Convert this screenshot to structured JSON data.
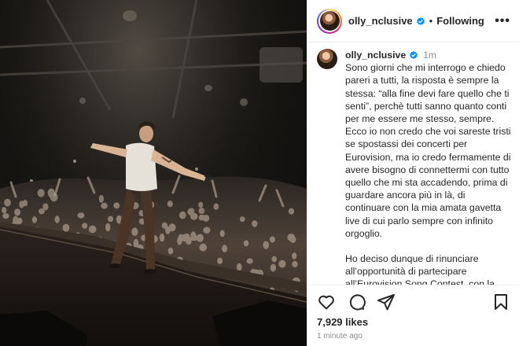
{
  "post": {
    "username": "olly_nclusive",
    "following_label": "Following",
    "more_label": "•••",
    "image_alt": "Performer on stage with arms outstretched facing a large concert crowd"
  },
  "caption": {
    "username": "olly_nclusive",
    "time": "1m",
    "paragraph1": "Sono giorni che mi interrogo e chiedo pareri a tutti, la risposta è sempre la stessa: “alla fine devi fare quello che ti senti”, perchè tutti sanno quanto conti per me essere me stesso, sempre.\nEcco io non credo che voi sareste tristi se spostassi dei concerti per Eurovision, ma io credo fermamente di avere bisogno di connettermi con tutto quello che mi sta accadendo, prima di guardare ancora più in là, di continuare con la mia amata gavetta live di cui parlo sempre con infinito orgoglio.",
    "paragraph2": "Ho deciso dunque di rinunciare all’opportunità di partecipare all’Eurovision Song Contest, con la consapevolezza che sia una di quelle cose che ti capitano forse una sola volta nella vita."
  },
  "stats": {
    "likes": "7,929 likes",
    "time_ago": "1 minute ago"
  },
  "icons": {
    "like": "heart-icon",
    "comment": "comment-icon",
    "share": "share-icon",
    "save": "bookmark-icon",
    "verified": "verified-badge-icon"
  },
  "colors": {
    "verified": "#0095f6",
    "text": "#262626",
    "muted": "#8e8e8e"
  }
}
